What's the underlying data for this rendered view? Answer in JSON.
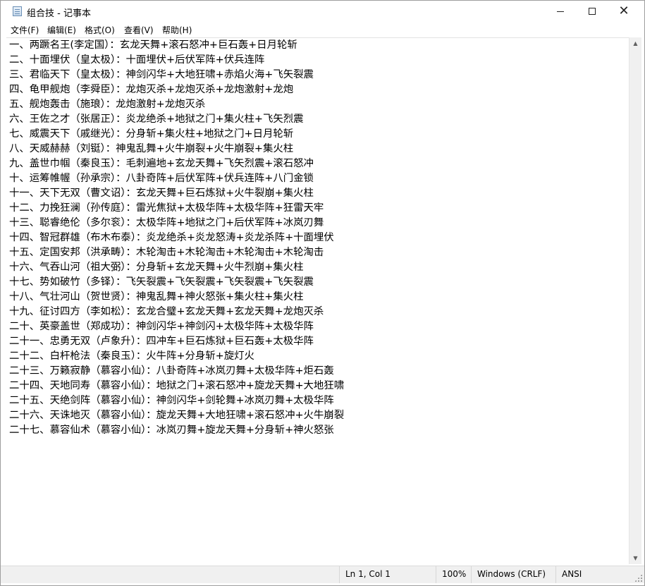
{
  "window": {
    "title": "组合技 - 记事本",
    "icon": "notepad-icon"
  },
  "menu": [
    "文件(F)",
    "编辑(E)",
    "格式(O)",
    "查看(V)",
    "帮助(H)"
  ],
  "lines": [
    "一、两蹶名王(李定国）：玄龙天舞+滚石怒冲+巨石轰+日月轮斩",
    "二、十面埋伏（皇太极）：十面埋伏+后伏军阵+伏兵连阵",
    "三、君临天下（皇太极）：神剑闪华+大地狂啸+赤焰火海+飞矢裂震",
    "四、龟甲舰炮（李舜臣）：龙炮灭杀+龙炮灭杀+龙炮激射+龙炮",
    "五、舰炮轰击（施琅）：龙炮激射+龙炮灭杀",
    "六、王佐之才（张居正）：炎龙绝杀+地狱之门+集火柱+飞矢烈震",
    "七、威震天下（戚继光）：分身斩+集火柱+地狱之门+日月轮斩",
    "八、天威赫赫（刘铤）：神鬼乱舞+火牛崩裂+火牛崩裂+集火柱",
    "九、盖世巾帼（秦良玉）：毛刺遍地+玄龙天舞+飞矢烈震+滚石怒冲",
    "十、运筹帷幄（孙承宗）：八卦奇阵+后伏军阵+伏兵连阵+八门金锁",
    "十一、天下无双（曹文诏）：玄龙天舞+巨石炼狱+火牛裂崩+集火柱",
    "十二、力挽狂澜（孙传庭）：雷光焦狱+太极华阵+太极华阵+狂雷天牢",
    "十三、聪睿绝伦（多尔衮）：太极华阵+地狱之门+后伏军阵+冰岚刃舞",
    "十四、智冠群雄（布木布泰）：炎龙绝杀+炎龙怒涛+炎龙杀阵+十面埋伏",
    "十五、定国安邦（洪承畴）：木轮淘击+木轮淘击+木轮淘击+木轮淘击",
    "十六、气吞山河（祖大弼）：分身斩+玄龙天舞+火牛烈崩+集火柱",
    "十七、势如破竹（多铎）：飞矢裂震+飞矢裂震+飞矢裂震+飞矢裂震",
    "十八、气壮河山（贺世贤）：神鬼乱舞+神火怒张+集火柱+集火柱",
    "十九、征讨四方（李如松）：玄龙合璧+玄龙天舞+玄龙天舞+龙炮灭杀",
    "二十、英豪盖世（郑成功）：神剑闪华+神剑闪+太极华阵+太极华阵",
    "二十一、忠勇无双（卢象升）：四冲车+巨石炼狱+巨石轰+太极华阵",
    "二十二、白杆枪法（秦良玉）：火牛阵+分身斩+旋灯火",
    "二十三、万籁寂静（慕容小仙）：八卦奇阵+冰岚刃舞+太极华阵+炬石轰",
    "二十四、天地同寿（慕容小仙）：地狱之门+滚石怒冲+旋龙天舞+大地狂啸",
    "二十五、天绝剑阵（慕容小仙）：神剑闪华+剑轮舞+冰岚刃舞+太极华阵",
    "二十六、天诛地灭（慕容小仙）：旋龙天舞+大地狂啸+滚石怒冲+火牛崩裂",
    "二十七、慕容仙术（慕容小仙）：冰岚刃舞+旋龙天舞+分身斩+神火怒张"
  ],
  "status": {
    "position": "Ln 1, Col 1",
    "zoom": "100%",
    "line_ending": "Windows (CRLF)",
    "encoding": "ANSI"
  }
}
